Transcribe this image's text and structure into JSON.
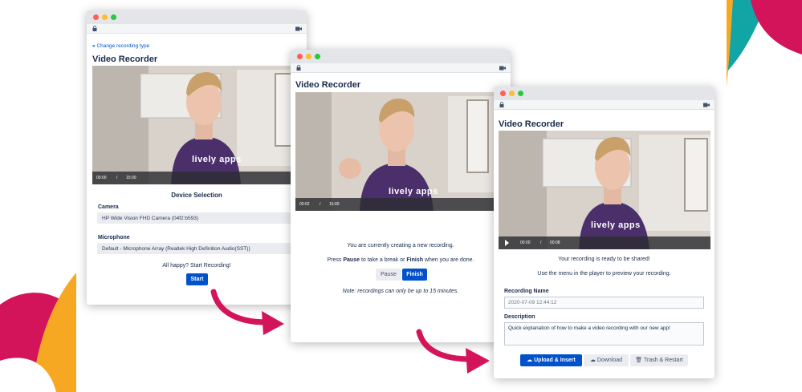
{
  "colors": {
    "primary": "#0052cc",
    "arrow": "#d4145a",
    "deco_magenta": "#d4145a",
    "deco_teal": "#12a5a5",
    "deco_orange": "#f7a823"
  },
  "window1": {
    "back_link": "Change recording type",
    "title": "Video Recorder",
    "video_time_current": "00:00",
    "video_time_sep": "/",
    "video_time_total": "15:00",
    "shirt_text": "lively apps",
    "section_heading": "Device Selection",
    "camera_label": "Camera",
    "camera_value": "HP Wide Vision FHD Camera (04f2:b593)",
    "microphone_label": "Microphone",
    "microphone_value": "Default - Microphone Array (Realtek High Definition Audio(SST))",
    "prompt": "All happy? Start Recording!",
    "start_button": "Start"
  },
  "window2": {
    "title": "Video Recorder",
    "video_time_current": "00:02",
    "video_time_sep": "/",
    "video_time_total": "15:00",
    "shirt_text": "lively apps",
    "status_line": "You are currently creating a new recording.",
    "instr_prefix": "Press",
    "instr_pause": "Pause",
    "instr_mid": "to take a break or",
    "instr_finish": "Finish",
    "instr_suffix": "when you are done.",
    "pause_button": "Pause",
    "finish_button": "Finish",
    "note": "Note: recordings can only be up to 15 minutes."
  },
  "window3": {
    "title": "Video Recorder",
    "video_time_current": "00:00",
    "video_time_sep": "/",
    "video_time_total": "00:08",
    "shirt_text": "lively apps",
    "ready_line": "Your recording is ready to be shared!",
    "menu_line": "Use the menu in the player to preview your recording.",
    "name_label": "Recording Name",
    "name_value": "2020-07-09 12:44:12",
    "description_label": "Description",
    "description_value": "Quick explanation of how to make a video recording with our new app!",
    "upload_button": "Upload & Insert",
    "download_button": "Download",
    "trash_button": "Trash & Restart"
  }
}
